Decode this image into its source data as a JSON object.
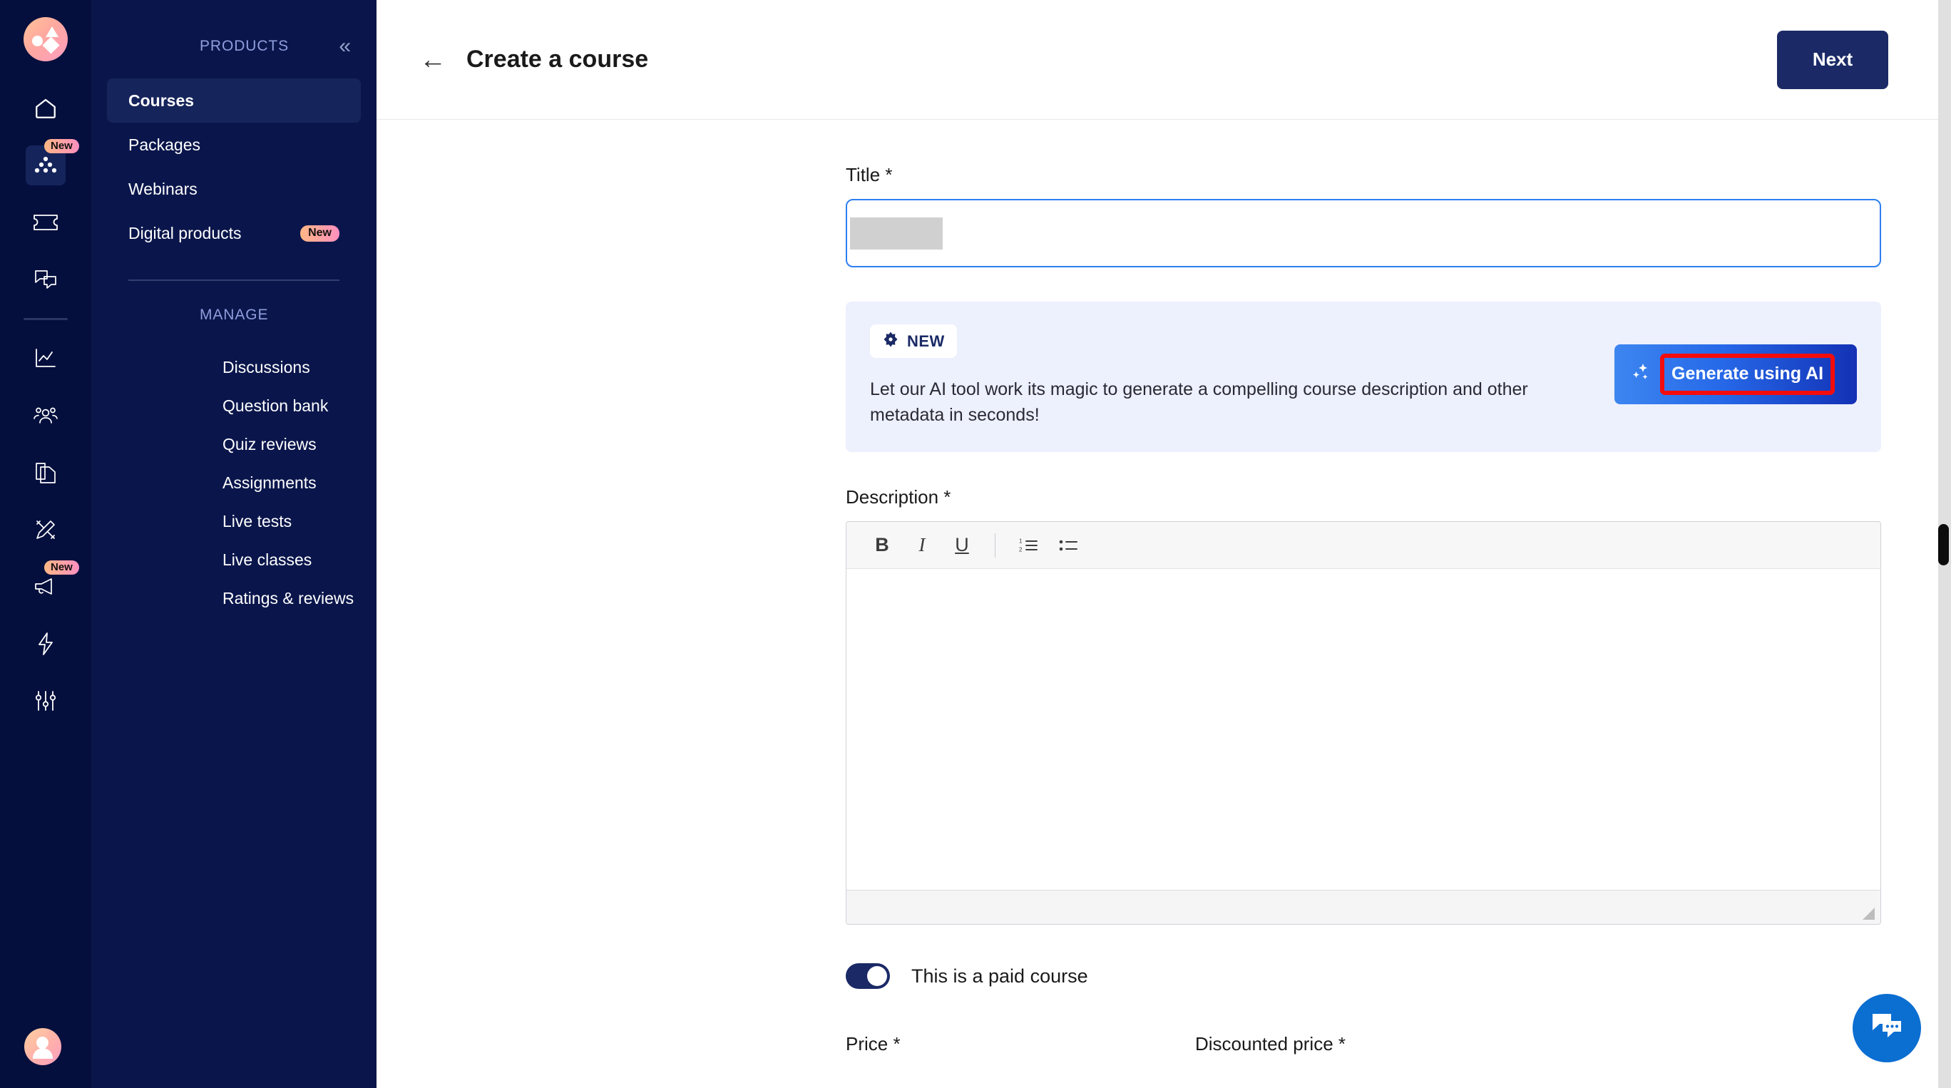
{
  "rail": {
    "logo_name": "brand-logo",
    "items": [
      {
        "icon": "home-icon",
        "badge": null,
        "active": false
      },
      {
        "icon": "products-dots-icon",
        "badge": "New",
        "active": true
      },
      {
        "icon": "ticket-icon",
        "badge": null,
        "active": false
      },
      {
        "icon": "chat-bubbles-icon",
        "badge": null,
        "active": false
      },
      {
        "icon": "analytics-chart-icon",
        "badge": null,
        "active": false
      },
      {
        "icon": "people-icon",
        "badge": null,
        "active": false
      },
      {
        "icon": "documents-copy-icon",
        "badge": null,
        "active": false
      },
      {
        "icon": "pencil-design-icon",
        "badge": null,
        "active": false
      },
      {
        "icon": "megaphone-icon",
        "badge": "New",
        "active": false
      },
      {
        "icon": "lightning-bolt-icon",
        "badge": null,
        "active": false
      },
      {
        "icon": "sliders-settings-icon",
        "badge": null,
        "active": false
      }
    ],
    "avatar_name": "user-avatar"
  },
  "subnav": {
    "section_products": "PRODUCTS",
    "collapse_icon": "double-chevron-left-icon",
    "products": [
      {
        "label": "Courses",
        "badge": null,
        "active": true
      },
      {
        "label": "Packages",
        "badge": null,
        "active": false
      },
      {
        "label": "Webinars",
        "badge": null,
        "active": false
      },
      {
        "label": "Digital products",
        "badge": "New",
        "active": false
      }
    ],
    "section_manage": "MANAGE",
    "manage": [
      {
        "label": "Discussions"
      },
      {
        "label": "Question bank"
      },
      {
        "label": "Quiz reviews"
      },
      {
        "label": "Assignments"
      },
      {
        "label": "Live tests"
      },
      {
        "label": "Live classes"
      },
      {
        "label": "Ratings & reviews"
      }
    ]
  },
  "topbar": {
    "back_icon": "back-arrow-icon",
    "title": "Create a course",
    "next_label": "Next"
  },
  "form": {
    "title_label": "Title *",
    "title_value": "",
    "title_placeholder": "",
    "description_label": "Description *",
    "description_value": "",
    "toolbar": {
      "bold": "B",
      "italic": "I",
      "underline": "U",
      "ordered_list_icon": "numbered-list-icon",
      "bullet_list_icon": "bullet-list-icon"
    },
    "paid_toggle_label": "This is a paid course",
    "paid_toggle_on": true,
    "price_label": "Price *",
    "discounted_price_label": "Discounted price *"
  },
  "ai_banner": {
    "badge_icon": "sparkle-badge-icon",
    "badge_label": "NEW",
    "body_text": "Let our AI tool work its magic to generate a compelling course description and other metadata in seconds!",
    "button_icon": "sparkles-icon",
    "button_label": "Generate using AI",
    "highlight_color": "#f40c0c"
  },
  "chat": {
    "icon": "chat-support-icon",
    "color": "#0b6ed1"
  },
  "colors": {
    "rail_bg": "#050f3d",
    "subnav_bg": "#0a164b",
    "active_nav": "#16245c",
    "accent_navy": "#1b2a66",
    "banner_bg": "#edf0fd",
    "focus_blue": "#2d7ff0"
  },
  "scrollbar": {
    "name": "page-scrollbar"
  }
}
